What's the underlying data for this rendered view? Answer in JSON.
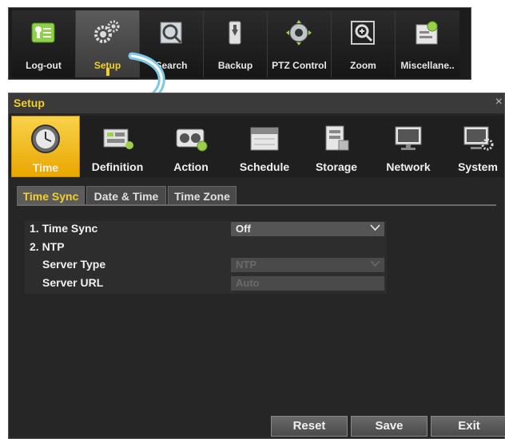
{
  "toolbar": {
    "items": [
      {
        "label": "Log-out",
        "icon": "logout-icon"
      },
      {
        "label": "Setup",
        "icon": "gears-icon",
        "active": true
      },
      {
        "label": "Search",
        "icon": "search-icon"
      },
      {
        "label": "Backup",
        "icon": "backup-icon"
      },
      {
        "label": "PTZ Control",
        "icon": "ptz-camera-icon"
      },
      {
        "label": "Zoom",
        "icon": "zoom-icon"
      },
      {
        "label": "Miscellane..",
        "icon": "misc-icon"
      }
    ],
    "accent_color": "#f3d02a"
  },
  "window": {
    "title": "Setup",
    "close_label": "×"
  },
  "categories": [
    {
      "label": "Time",
      "icon": "clock-icon",
      "active": true
    },
    {
      "label": "Definition",
      "icon": "definition-icon"
    },
    {
      "label": "Action",
      "icon": "action-icon"
    },
    {
      "label": "Schedule",
      "icon": "schedule-icon"
    },
    {
      "label": "Storage",
      "icon": "storage-icon"
    },
    {
      "label": "Network",
      "icon": "network-monitor-icon"
    },
    {
      "label": "System",
      "icon": "system-icon"
    }
  ],
  "tabs": [
    {
      "label": "Time Sync",
      "active": true
    },
    {
      "label": "Date & Time"
    },
    {
      "label": "Time Zone"
    }
  ],
  "form": {
    "time_sync_label": "1. Time Sync",
    "time_sync_value": "Off",
    "ntp_label": "2. NTP",
    "server_type_label": "Server Type",
    "server_type_value": "NTP",
    "server_url_label": "Server URL",
    "server_url_value": "Auto"
  },
  "buttons": {
    "reset": "Reset",
    "save": "Save",
    "exit": "Exit"
  }
}
